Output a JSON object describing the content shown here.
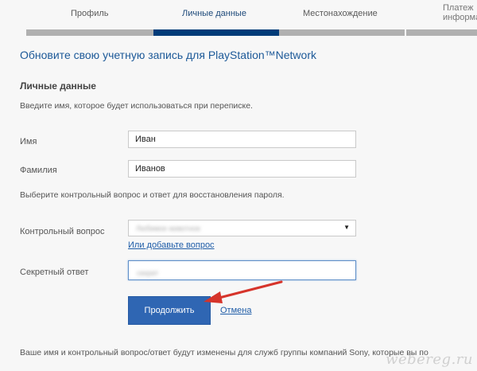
{
  "steps": [
    {
      "label": "Профиль",
      "state": "complete"
    },
    {
      "label": "Личные данные",
      "state": "active"
    },
    {
      "label": "Местонахождение",
      "state": "upcoming"
    },
    {
      "label_line1": "Платеж",
      "label_line2": "информа",
      "state": "upcoming"
    }
  ],
  "heading": "Обновите свою учетную запись для PlayStation™Network",
  "section_title": "Личные данные",
  "name_instruction": "Введите имя, которое будет использоваться при переписке.",
  "fields": {
    "first_name": {
      "label": "Имя",
      "value": "Иван"
    },
    "last_name": {
      "label": "Фамилия",
      "value": "Иванов"
    }
  },
  "security_instruction": "Выберите контрольный вопрос и ответ для восстановления пароля.",
  "security_question": {
    "label": "Контрольный вопрос",
    "selected_value": "Любимое животное",
    "add_question_link": "Или добавьте вопрос"
  },
  "secret_answer": {
    "label": "Секретный ответ",
    "value": "секрет"
  },
  "actions": {
    "continue_label": "Продолжить",
    "cancel_label": "Отмена"
  },
  "footer_note": "Ваше имя и контрольный вопрос/ответ будут изменены для служб группы компаний Sony, которые вы по",
  "watermark": "webereg.ru",
  "colors": {
    "progress_active": "#003b78",
    "progress_inactive": "#b0b0b0",
    "link": "#1f5da8",
    "heading": "#1c5998",
    "button": "#2f66b3",
    "annotation_arrow": "#d6342b"
  }
}
